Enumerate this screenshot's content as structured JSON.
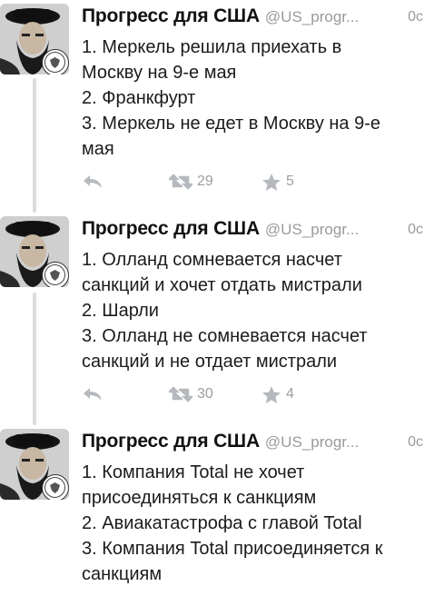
{
  "tweets": [
    {
      "author_name": "Прогресс для США",
      "author_handle": "@US_progr...",
      "time": "0с",
      "lines": [
        "1. Меркель решила приехать в",
        "Москву на 9-е мая",
        "2. Франкфурт",
        "3. Меркель не едет в Москву на 9-е",
        "мая"
      ],
      "retweets": "29",
      "favorites": "5"
    },
    {
      "author_name": "Прогресс для США",
      "author_handle": "@US_progr...",
      "time": "0с",
      "lines": [
        "1. Олланд сомневается насчет",
        "санкций и хочет отдать мистрали",
        "2. Шарли",
        "3. Олланд не сомневается насчет",
        "санкций и не отдает мистрали"
      ],
      "retweets": "30",
      "favorites": "4"
    },
    {
      "author_name": "Прогресс для США",
      "author_handle": "@US_progr...",
      "time": "0с",
      "lines": [
        "1. Компания Total не хочет",
        "присоединяться к санкциям",
        "2. Авиакатастрофа с главой Total",
        "3. Компания Total присоединяется к",
        "санкциям"
      ]
    }
  ],
  "colors": {
    "text": "#1b1b1b",
    "muted": "#9a9a9a",
    "icon": "#b5b9bd",
    "thread_line": "#dcdcdc"
  },
  "icons": [
    "reply-icon",
    "retweet-icon",
    "star-icon",
    "avatar-image",
    "seal-icon"
  ]
}
